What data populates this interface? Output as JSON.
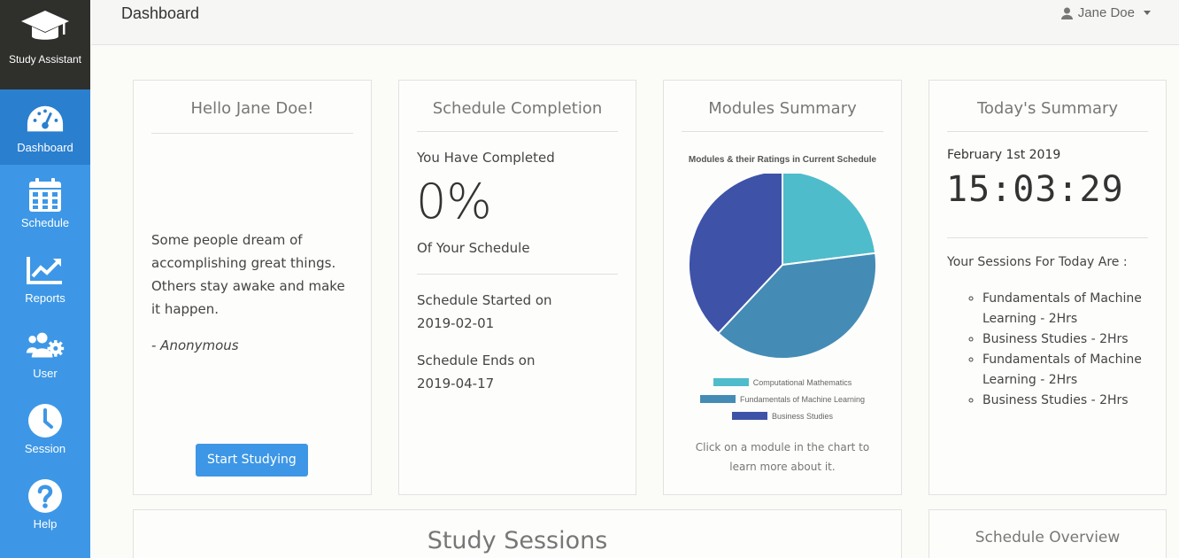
{
  "brand": {
    "name": "Study Assistant",
    "icon": "graduation-cap-icon"
  },
  "sidebar": {
    "items": [
      {
        "label": "Dashboard",
        "icon": "speedometer-icon",
        "active": true
      },
      {
        "label": "Schedule",
        "icon": "calendar-icon"
      },
      {
        "label": "Reports",
        "icon": "chart-line-icon"
      },
      {
        "label": "User",
        "icon": "users-cog-icon"
      },
      {
        "label": "Session",
        "icon": "clock-icon"
      },
      {
        "label": "Help",
        "icon": "question-icon"
      }
    ]
  },
  "header": {
    "title": "Dashboard",
    "user": "Jane Doe"
  },
  "greeting": {
    "title": "Hello Jane Doe!",
    "quote": "Some people dream of accomplishing great things. Others stay awake and make it happen.",
    "author": "- Anonymous",
    "button": "Start Studying"
  },
  "completion": {
    "title": "Schedule Completion",
    "lead": "You Have Completed",
    "percent": "0%",
    "trail": "Of Your Schedule",
    "started_label": "Schedule Started on",
    "started_date": "2019-02-01",
    "ends_label": "Schedule Ends on",
    "ends_date": "2019-04-17"
  },
  "modules": {
    "title": "Modules Summary",
    "hint": "Click on a module in the chart to learn more about it."
  },
  "chart_data": {
    "type": "pie",
    "title": "Modules & their Ratings in Current Schedule",
    "legend_position": "bottom",
    "series": [
      {
        "name": "Computational Mathematics",
        "value": 23,
        "color": "#4fbccb"
      },
      {
        "name": "Fundamentals of Machine Learning",
        "value": 39,
        "color": "#448cb5"
      },
      {
        "name": "Business Studies",
        "value": 38,
        "color": "#3e52a8"
      }
    ]
  },
  "today": {
    "title": "Today's Summary",
    "date": "February 1st 2019",
    "time": "15:03:29",
    "sessions_label": "Your Sessions For Today Are :",
    "sessions": [
      "Fundamentals of Machine Learning - 2Hrs",
      "Business Studies - 2Hrs",
      "Fundamentals of Machine Learning - 2Hrs",
      "Business Studies - 2Hrs"
    ]
  },
  "study_sessions": {
    "title": "Study Sessions"
  },
  "schedule_overview": {
    "title": "Schedule Overview"
  },
  "colors": {
    "accent": "#3d97e6",
    "sidebar_active": "#2a7fcf",
    "brand_bg": "#2f2f2c"
  }
}
